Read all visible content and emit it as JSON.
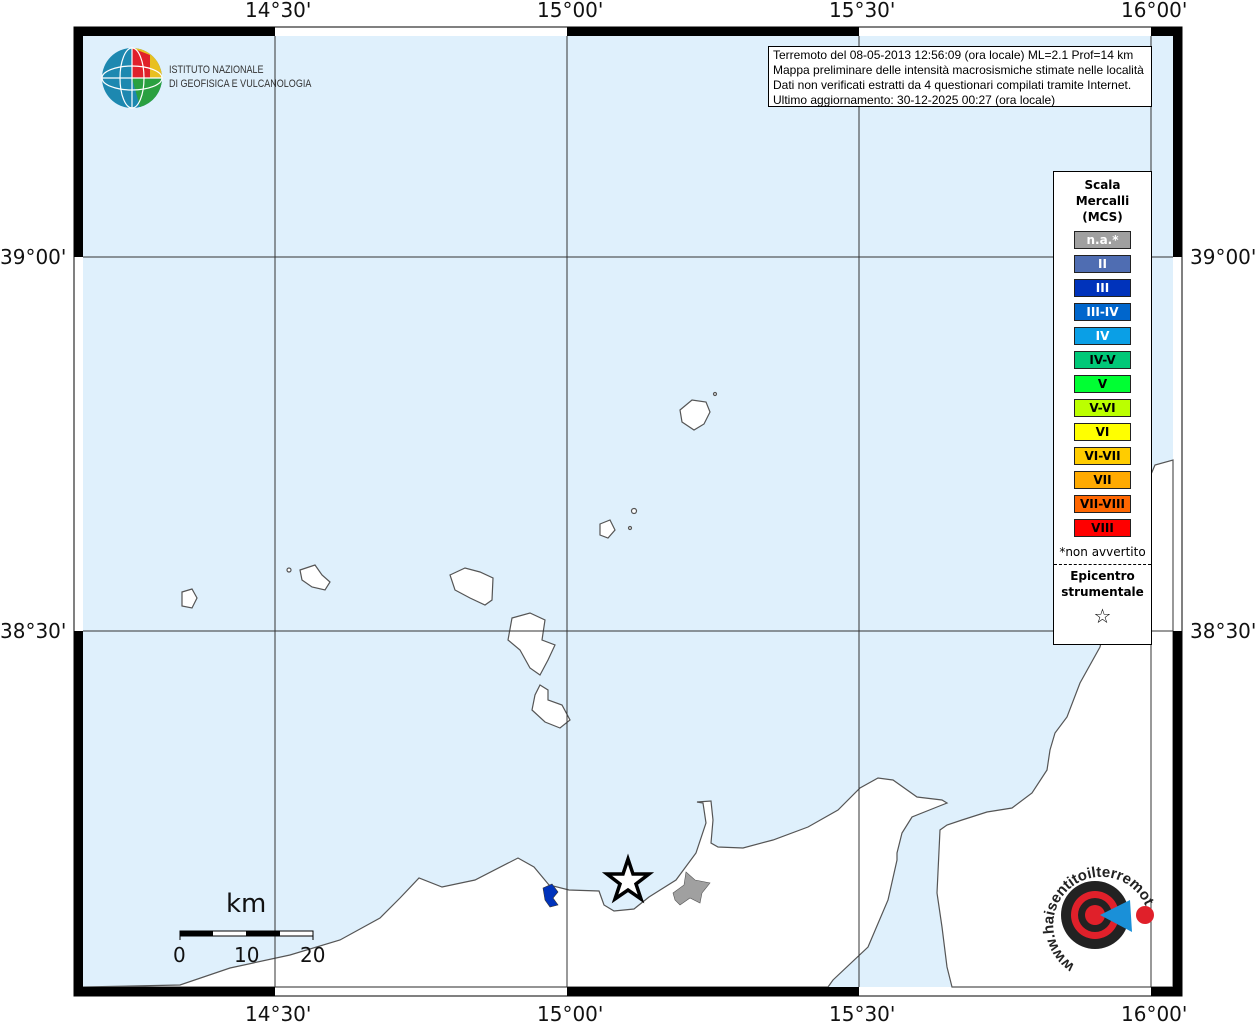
{
  "map": {
    "water_color": "#dff0fc",
    "land_color": "#ffffff",
    "lon_labels": [
      "14°30'",
      "15°00'",
      "15°30'",
      "16°00'"
    ],
    "lat_labels": [
      "39°00'",
      "38°30'"
    ]
  },
  "logo": {
    "line1": "ISTITUTO NAZIONALE",
    "line2": "DI GEOFISICA E VULCANOLOGIA"
  },
  "info": {
    "lines": [
      "Terremoto del 08-05-2013 12:56:09 (ora locale) ML=2.1 Prof=14 km",
      "Mappa preliminare delle intensità macrosismiche stimate nelle località",
      "Dati non verificati estratti da 4 questionari compilati tramite Internet.",
      "Ultimo aggiornamento: 30-12-2025 00:27 (ora locale)"
    ]
  },
  "legend": {
    "title": [
      "Scala",
      "Mercalli",
      "(MCS)"
    ],
    "items": [
      {
        "label": "n.a.*",
        "color": "#a0a0a0",
        "text": "#ffffff"
      },
      {
        "label": "II",
        "color": "#4f6db2",
        "text": "#ffffff"
      },
      {
        "label": "III",
        "color": "#0033bb",
        "text": "#ffffff"
      },
      {
        "label": "III-IV",
        "color": "#0066cc",
        "text": "#ffffff"
      },
      {
        "label": "IV",
        "color": "#0a9fe6",
        "text": "#ffffff"
      },
      {
        "label": "IV-V",
        "color": "#00c878",
        "text": "#000000"
      },
      {
        "label": "V",
        "color": "#00ff33",
        "text": "#000000"
      },
      {
        "label": "V-VI",
        "color": "#bbff00",
        "text": "#000000"
      },
      {
        "label": "VI",
        "color": "#ffff00",
        "text": "#000000"
      },
      {
        "label": "VI-VII",
        "color": "#ffcc00",
        "text": "#000000"
      },
      {
        "label": "VII",
        "color": "#ffaa00",
        "text": "#000000"
      },
      {
        "label": "VII-VIII",
        "color": "#ff6600",
        "text": "#000000"
      },
      {
        "label": "VIII",
        "color": "#ff0000",
        "text": "#000000"
      }
    ],
    "note": "*non avvertito",
    "epicentro": [
      "Epicentro",
      "strumentale"
    ],
    "star": "☆"
  },
  "scale": {
    "unit": "km",
    "ticks": [
      "0",
      "10",
      "20"
    ]
  },
  "brand": {
    "text": "www.haisentitoilterremoto.it"
  }
}
